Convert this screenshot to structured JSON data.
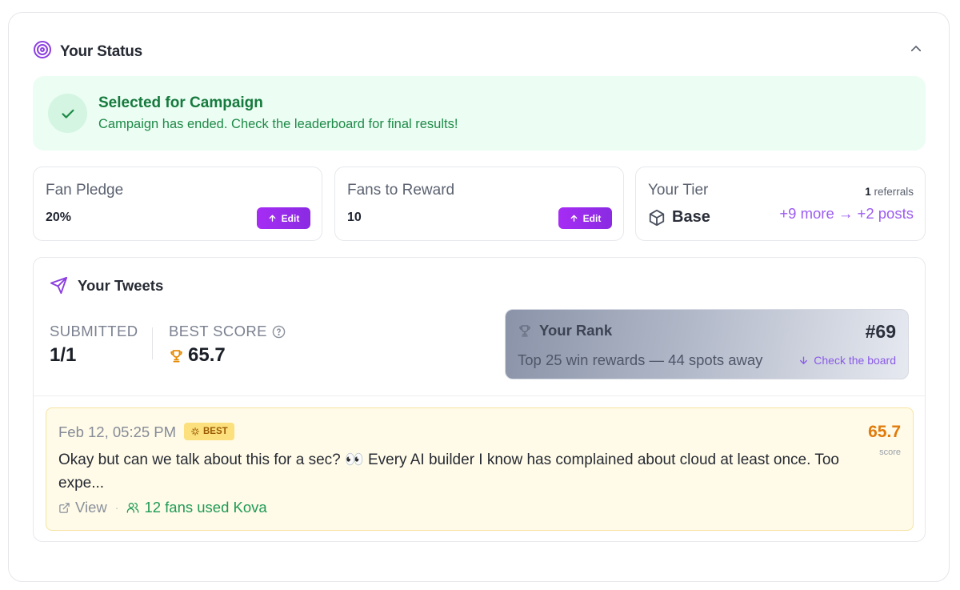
{
  "header": {
    "title": "Your Status"
  },
  "banner": {
    "title": "Selected for Campaign",
    "subtitle": "Campaign has ended. Check the leaderboard for final results!"
  },
  "cards": {
    "fan_pledge": {
      "label": "Fan Pledge",
      "value": "20%",
      "edit_label": "Edit"
    },
    "fans_to_reward": {
      "label": "Fans to Reward",
      "value": "10",
      "edit_label": "Edit"
    },
    "tier": {
      "label": "Your Tier",
      "value": "Base",
      "referrals_count": "1",
      "referrals_label": "referrals",
      "more_text": "+9 more → +2 posts"
    }
  },
  "tweets": {
    "title": "Your Tweets",
    "submitted_label": "SUBMITTED",
    "submitted_value": "1/1",
    "best_score_label": "BEST SCORE",
    "best_score_value": "65.7",
    "rank": {
      "title": "Your Rank",
      "value": "#69",
      "subtitle": "Top 25 win rewards — 44 spots away",
      "link": "Check the board"
    },
    "items": [
      {
        "date": "Feb 12, 05:25 PM",
        "badge": "BEST",
        "text": "Okay but can we talk about this for a sec? 👀  Every AI builder I know has complained about cloud at least once. Too expe...",
        "score": "65.7",
        "score_label": "score",
        "view_label": "View",
        "fans_label": "12 fans used Kova"
      }
    ]
  },
  "colors": {
    "accent": "#8a2be2",
    "success": "#157a3d",
    "success_bg": "#ecfdf3",
    "score": "#e07b0c",
    "highlight_bg": "#fffbe8"
  },
  "icons": {
    "header": "target-icon",
    "collapse": "chevron-up-icon",
    "banner": "check-icon",
    "edit": "arrow-up-icon",
    "tier": "box-icon",
    "tweets": "send-icon",
    "help": "question-circle-icon",
    "best_score": "trophy-icon",
    "rank": "trophy-icon",
    "rank_link": "arrow-down-icon",
    "badge": "sparkle-icon",
    "view": "external-link-icon",
    "fans": "users-icon"
  }
}
